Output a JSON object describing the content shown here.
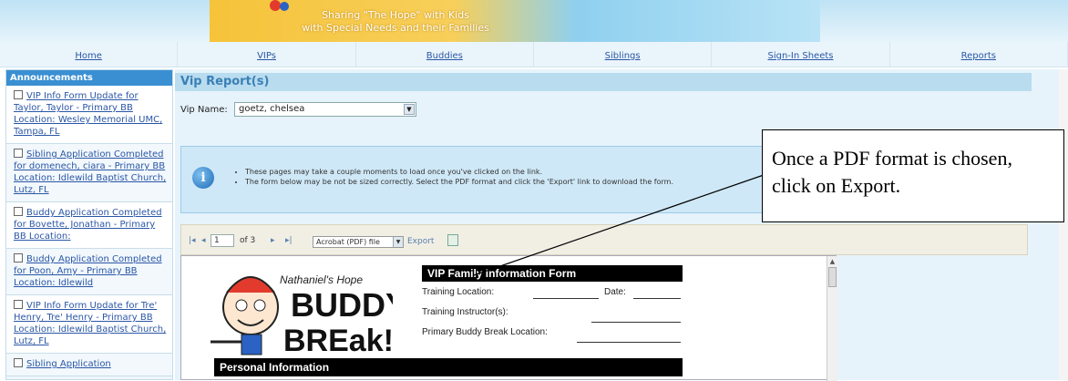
{
  "banner": {
    "text_line1": "Sharing \"The Hope\" with Kids",
    "text_line2": "with Special Needs and their Families"
  },
  "nav": {
    "items": [
      "Home",
      "VIPs",
      "Buddies",
      "Siblings",
      "Sign-In Sheets",
      "Reports"
    ]
  },
  "sidebar": {
    "title": "Announcements",
    "items": [
      "VIP Info Form Update for Taylor, Taylor - Primary BB Location: Wesley Memorial UMC, Tampa, FL",
      "Sibling Application Completed for domenech, ciara - Primary BB Location: Idlewild Baptist Church, Lutz, FL",
      "Buddy Application Completed for Bovette, Jonathan - Primary BB Location:",
      "Buddy Application Completed for Poon, Amy - Primary BB Location: Idlewild",
      "VIP Info Form Update for Tre' Henry, Tre' Henry - Primary BB Location: Idlewild Baptist Church, Lutz, FL",
      "Sibling Application"
    ]
  },
  "main": {
    "section_title": "Vip Report(s)",
    "vip_label": "Vip Name:",
    "vip_value": "goetz, chelsea",
    "info_icon": "i",
    "info_items": [
      "These pages may take a couple moments to load once you've clicked on the link.",
      "The form below may be not be sized correctly. Select the PDF format and click the 'Export' link to download the form."
    ]
  },
  "toolbar": {
    "first": "|◂",
    "prev": "◂",
    "page": "1",
    "of_pages": "of 3",
    "next": "▸",
    "last": "▸|",
    "format": "Acrobat (PDF) file",
    "export": "Export"
  },
  "report": {
    "logo_top": "Nathaniel's Hope",
    "logo_main1": "BUDDY",
    "logo_main2": "BREak!",
    "form_title": "VIP Family Information Form",
    "training_location": "Training Location:",
    "date": "Date:",
    "training_instructors": "Training Instructor(s):",
    "primary_location": "Primary Buddy Break Location:",
    "personal_info": "Personal Information"
  },
  "callout": {
    "text": "Once a PDF format is chosen, click on Export."
  }
}
